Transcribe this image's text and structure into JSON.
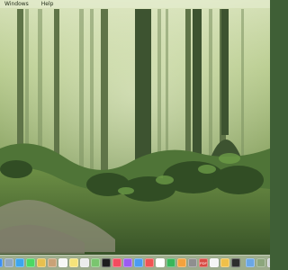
{
  "menubar": {
    "items": [
      "Windows",
      "Help"
    ]
  },
  "dock": {
    "icons": [
      {
        "name": "finder-icon",
        "color": "#3b8ef2"
      },
      {
        "name": "launchpad-icon",
        "color": "#8fa7c2"
      },
      {
        "name": "safari-icon",
        "color": "#3ca6ee"
      },
      {
        "name": "messages-icon",
        "color": "#4bd863"
      },
      {
        "name": "photos-icon",
        "color": "#e7c04e"
      },
      {
        "name": "contacts-icon",
        "color": "#c9a277"
      },
      {
        "name": "calendar-icon",
        "color": "#f7f7f7"
      },
      {
        "name": "notes-icon",
        "color": "#f5e47a"
      },
      {
        "name": "reminders-icon",
        "color": "#ececec"
      },
      {
        "name": "maps-icon",
        "color": "#7ac56f"
      },
      {
        "name": "tv-icon",
        "color": "#1e1e1e"
      },
      {
        "name": "music-icon",
        "color": "#f34b5f"
      },
      {
        "name": "podcasts-icon",
        "color": "#9b5cf1"
      },
      {
        "name": "app-store-icon",
        "color": "#4a9bf2"
      },
      {
        "name": "news-icon",
        "color": "#f15353"
      },
      {
        "name": "keynote-icon",
        "color": "#ffffff"
      },
      {
        "name": "numbers-icon",
        "color": "#39b65a"
      },
      {
        "name": "pages-icon",
        "color": "#f4a23d"
      },
      {
        "name": "settings-icon",
        "color": "#8f8f8f"
      },
      {
        "name": "pdf-icon",
        "color": "#d94b44",
        "label": "PDF"
      },
      {
        "name": "preview-icon",
        "color": "#f5f5f5"
      },
      {
        "name": "chrome-icon",
        "color": "#f0c04a"
      },
      {
        "name": "terminal-icon",
        "color": "#2d2d2d"
      },
      {
        "name": "downloads-folder-icon",
        "color": "#6aa7e6"
      },
      {
        "name": "photo-thumb-icon",
        "color": "#8ca67c"
      },
      {
        "name": "trash-icon",
        "color": "#cfd3d6"
      }
    ]
  },
  "theme": {
    "menubarText": "#1f2a16"
  }
}
